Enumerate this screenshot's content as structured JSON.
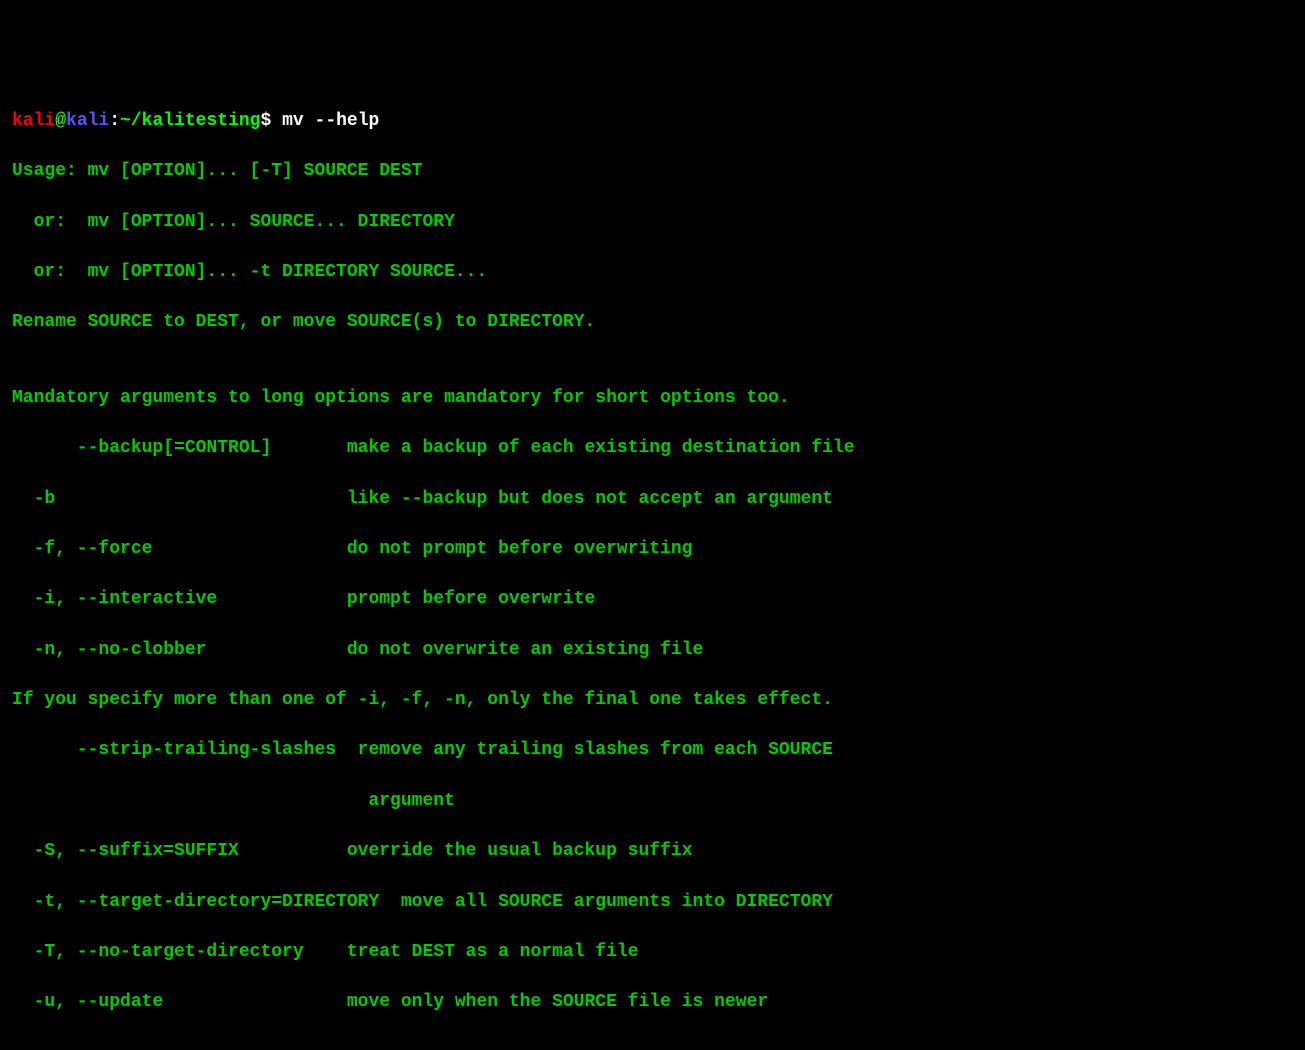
{
  "prompt": {
    "user": "kali",
    "at": "@",
    "host": "kali",
    "colon": ":",
    "path": "~/kalitesting",
    "dollar": "$",
    "command": " mv --help"
  },
  "lines": [
    "Usage: mv [OPTION]... [-T] SOURCE DEST",
    "  or:  mv [OPTION]... SOURCE... DIRECTORY",
    "  or:  mv [OPTION]... -t DIRECTORY SOURCE...",
    "Rename SOURCE to DEST, or move SOURCE(s) to DIRECTORY.",
    "",
    "Mandatory arguments to long options are mandatory for short options too.",
    "      --backup[=CONTROL]       make a backup of each existing destination file",
    "  -b                           like --backup but does not accept an argument",
    "  -f, --force                  do not prompt before overwriting",
    "  -i, --interactive            prompt before overwrite",
    "  -n, --no-clobber             do not overwrite an existing file",
    "If you specify more than one of -i, -f, -n, only the final one takes effect.",
    "      --strip-trailing-slashes  remove any trailing slashes from each SOURCE",
    "                                 argument",
    "  -S, --suffix=SUFFIX          override the usual backup suffix",
    "  -t, --target-directory=DIRECTORY  move all SOURCE arguments into DIRECTORY",
    "  -T, --no-target-directory    treat DEST as a normal file",
    "  -u, --update                 move only when the SOURCE file is newer"
  ]
}
